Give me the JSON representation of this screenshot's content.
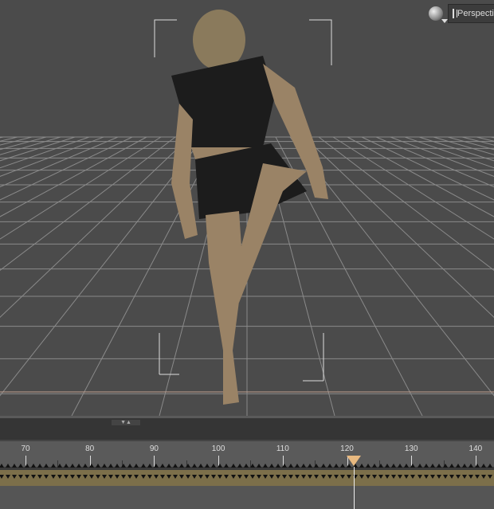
{
  "viewport": {
    "camera_label": "Perspective",
    "camera_label_visible": "Perspe",
    "render_icon": "sphere-render-icon",
    "camera_icon": "window-icon"
  },
  "timeline": {
    "labels": [
      "70",
      "80",
      "90",
      "100",
      "110",
      "120",
      "130",
      "140"
    ],
    "current_frame": 121,
    "playhead_color": "#e8b980",
    "keys_color": "#7c6f4a"
  }
}
